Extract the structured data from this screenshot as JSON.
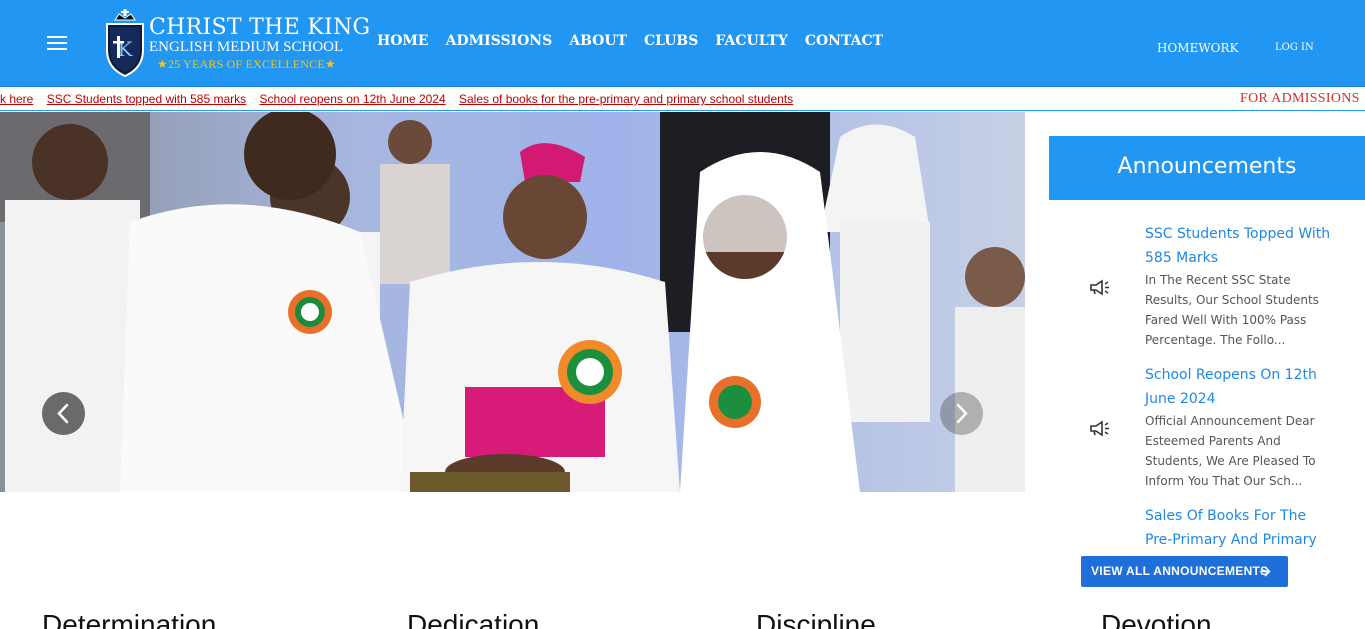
{
  "header": {
    "school_name": "CHRIST THE KING",
    "school_subtitle": "ENGLISH MEDIUM SCHOOL",
    "school_tagline": "★25 YEARS OF EXCELLENCE★",
    "nav": [
      "HOME",
      "ADMISSIONS",
      "ABOUT",
      "CLUBS",
      "FACULTY",
      "CONTACT"
    ],
    "homework": "HOMEWORK",
    "login": "LOG IN"
  },
  "ticker": {
    "items": [
      "k here",
      "SSC Students topped with 585 marks",
      "School reopens on 12th June 2024",
      "Sales of books for the pre-primary and primary school students"
    ],
    "right_text": "FOR ADMISSIONS"
  },
  "announcements": {
    "heading": "Announcements",
    "items": [
      {
        "title": "SSC Students Topped With 585 Marks",
        "body": "In The Recent SSC State Results, Our School Students Fared Well With 100% Pass Percentage. The Follo..."
      },
      {
        "title": "School Reopens On 12th June 2024",
        "body": "Official Announcement Dear Esteemed Parents And Students, We Are Pleased To Inform You That Our Sch..."
      },
      {
        "title": "Sales Of Books For The Pre-Primary And Primary School",
        "body": ""
      }
    ],
    "view_all": "VIEW ALL ANNOUNCEMENTS"
  },
  "values": [
    "Determination",
    "Dedication",
    "Discipline",
    "Devotion"
  ],
  "colors": {
    "brand_blue": "#2196f3",
    "link_blue": "#1e88e5",
    "ticker_red": "#c00000"
  }
}
